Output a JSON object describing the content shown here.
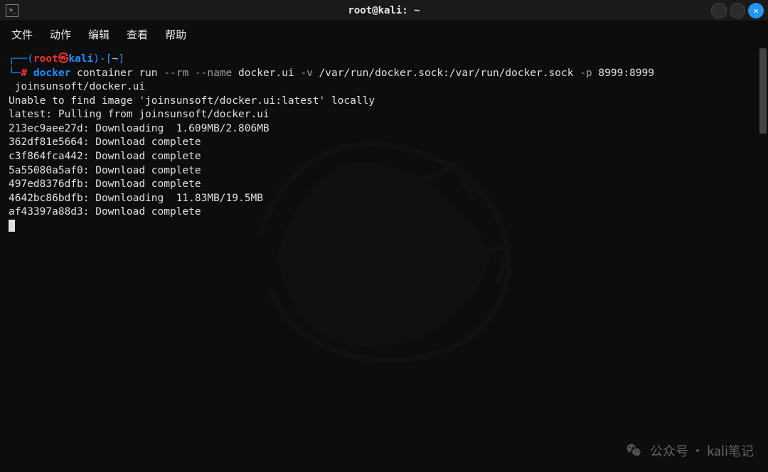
{
  "window": {
    "title": "root@kali: ~"
  },
  "menu": {
    "file": "文件",
    "action": "动作",
    "edit": "编辑",
    "view": "查看",
    "help": "帮助"
  },
  "prompt": {
    "open_paren": "┌──(",
    "user": "root",
    "at": "㉿",
    "host": "kali",
    "close_paren": ")-",
    "path_open": "[",
    "path": "~",
    "path_close": "]",
    "line2_prefix": "└─",
    "symbol": "#"
  },
  "command": {
    "part1": " docker",
    "part2": " container run ",
    "flag1": "--rm",
    "part3": " ",
    "flag2": "--name",
    "part4": " docker.ui ",
    "flag3": "-v",
    "part5": " /var/run/docker.sock:/var/run/docker.sock ",
    "flag4": "-p",
    "part6": " 8999:8999",
    "continuation": " joinsunsoft/docker.ui"
  },
  "output": {
    "lines": [
      "Unable to find image 'joinsunsoft/docker.ui:latest' locally",
      "latest: Pulling from joinsunsoft/docker.ui",
      "213ec9aee27d: Downloading  1.609MB/2.806MB",
      "362df81e5664: Download complete",
      "c3f864fca442: Download complete",
      "5a55080a5af0: Download complete",
      "497ed8376dfb: Download complete",
      "4642bc86bdfb: Downloading  11.83MB/19.5MB",
      "af43397a88d3: Download complete"
    ]
  },
  "watermark": {
    "text": "公众号 · kali笔记"
  }
}
